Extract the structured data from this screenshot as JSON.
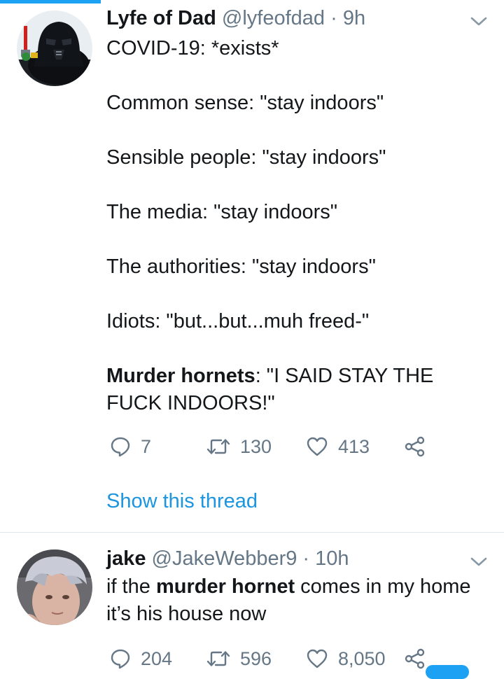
{
  "ui": {
    "accent": "#1da1f2",
    "link_color": "#1b95e0",
    "muted": "#657786",
    "text": "#14171a",
    "scroll_progress": 0.2
  },
  "tweets": [
    {
      "name": "Lyfe of Dad",
      "handle": "@lyfeofdad",
      "separator": "·",
      "time": "9h",
      "avatar_icon": "darth-vader-lego-avatar",
      "lines": [
        "COVID-19: *exists*",
        "Common sense: \"stay indoors\"",
        "Sensible people: \"stay indoors\"",
        "The media: \"stay indoors\"",
        "The authorities: \"stay indoors\"",
        "Idiots: \"but...but...muh freed-\""
      ],
      "last_line_bold": "Murder hornets",
      "last_line_rest": ": \"I SAID STAY THE FUCK INDOORS!\"",
      "replies": "7",
      "retweets": "130",
      "likes": "413",
      "show_thread": "Show this thread"
    },
    {
      "name": "jake",
      "handle": "@JakeWebber9",
      "separator": "·",
      "time": "10h",
      "avatar_icon": "silver-hair-person-avatar",
      "text_before": "if the ",
      "text_bold": "murder hornet",
      "text_after": " comes in my home it’s his house now",
      "replies": "204",
      "retweets": "596",
      "likes": "8,050"
    }
  ]
}
